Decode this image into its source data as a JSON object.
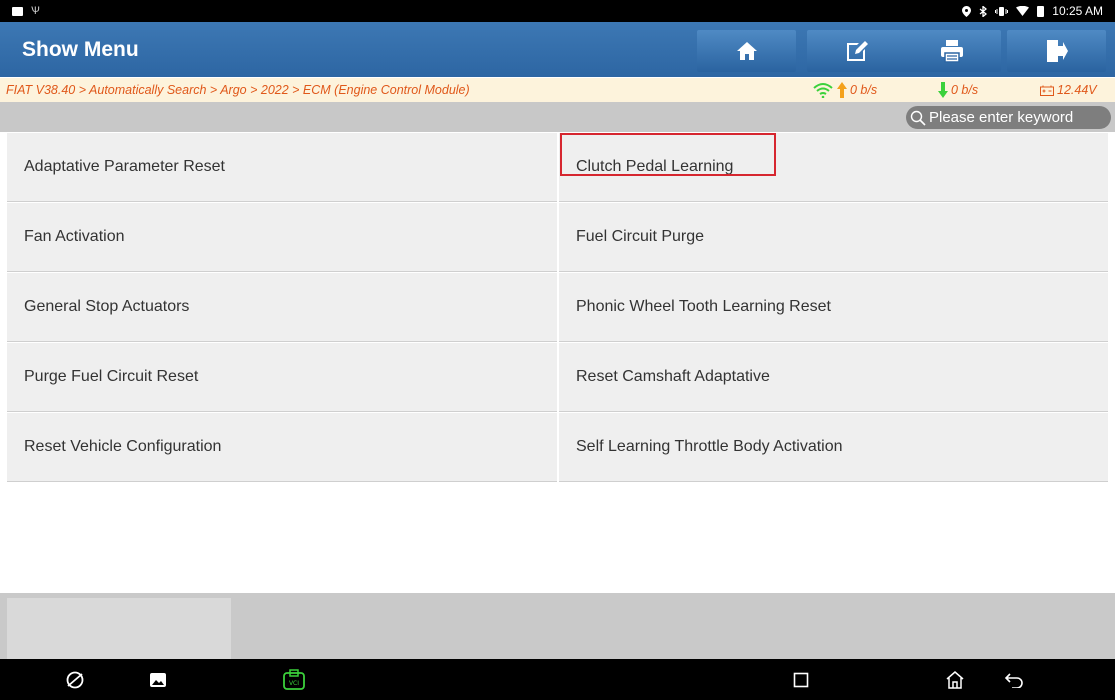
{
  "status_bar": {
    "time": "10:25 AM"
  },
  "header": {
    "title": "Show Menu",
    "buttons": [
      {
        "icon": "home-icon"
      },
      {
        "icon": "edit-icon"
      },
      {
        "icon": "print-icon"
      },
      {
        "icon": "exit-icon"
      }
    ]
  },
  "breadcrumb": {
    "path": "FIAT V38.40 > Automatically Search > Argo > 2022 > ECM (Engine Control Module)",
    "upload_rate": "0 b/s",
    "download_rate": "0 b/s",
    "voltage": "12.44V"
  },
  "search": {
    "placeholder": "Please enter keyword"
  },
  "menu": {
    "items": [
      {
        "label": "Adaptative Parameter Reset"
      },
      {
        "label": "Clutch Pedal Learning",
        "highlighted": true
      },
      {
        "label": "Fan Activation"
      },
      {
        "label": "Fuel Circuit Purge"
      },
      {
        "label": "General Stop Actuators"
      },
      {
        "label": "Phonic Wheel Tooth Learning Reset"
      },
      {
        "label": "Purge Fuel Circuit Reset"
      },
      {
        "label": "Reset Camshaft Adaptative"
      },
      {
        "label": "Reset Vehicle Configuration"
      },
      {
        "label": "Self Learning Throttle Body Activation"
      }
    ]
  },
  "navigation_bar": {
    "icons": [
      "browser-icon",
      "gallery-icon",
      "vci-icon",
      "recents-icon",
      "home-icon",
      "back-icon"
    ]
  },
  "colors": {
    "header_blue": "#3d78b4",
    "breadcrumb_text": "#e0581a",
    "highlight_red": "#d6262f",
    "vci_green": "#3bd13b"
  }
}
